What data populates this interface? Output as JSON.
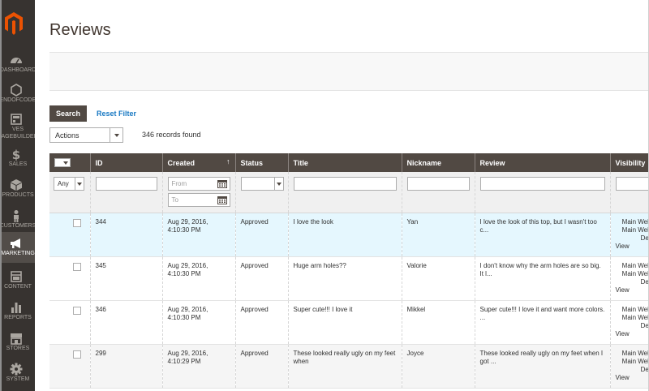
{
  "page": {
    "title": "Reviews"
  },
  "sidebar": {
    "items": [
      {
        "label": "DASHBOARD",
        "icon": "dashboard-icon"
      },
      {
        "label": "VENDOFCODER",
        "icon": "hexagon-icon"
      },
      {
        "label": "VES\nPAGEBUILDER",
        "icon": "page-builder-icon"
      },
      {
        "label": "SALES",
        "icon": "dollar-icon"
      },
      {
        "label": "PRODUCTS",
        "icon": "box-icon"
      },
      {
        "label": "CUSTOMERS",
        "icon": "person-icon"
      },
      {
        "label": "MARKETING",
        "icon": "megaphone-icon",
        "active": true
      },
      {
        "label": "CONTENT",
        "icon": "content-icon"
      },
      {
        "label": "REPORTS",
        "icon": "bar-chart-icon"
      },
      {
        "label": "STORES",
        "icon": "store-icon"
      },
      {
        "label": "SYSTEM",
        "icon": "gear-icon"
      }
    ]
  },
  "toolbar": {
    "search_label": "Search",
    "reset_label": "Reset Filter",
    "actions_label": "Actions",
    "records_found": "346 records found"
  },
  "grid": {
    "columns": [
      "",
      "ID",
      "Created",
      "Status",
      "Title",
      "Nickname",
      "Review",
      "Visibility"
    ],
    "filters": {
      "any": "Any",
      "from_placeholder": "From",
      "to_placeholder": "To"
    },
    "rows": [
      {
        "id": "344",
        "created": "Aug 29, 2016,\n4:10:30 PM",
        "status": "Approved",
        "title": "I love the look",
        "nickname": "Yan",
        "review": "I love the look of this top, but I wasn't too c...",
        "visibility": "Main Website\nMain Website\nDefault",
        "link": "View"
      },
      {
        "id": "345",
        "created": "Aug 29, 2016,\n4:10:30 PM",
        "status": "Approved",
        "title": "Huge arm holes??",
        "nickname": "Valorie",
        "review": "I don't know why the arm holes are so big. It l...",
        "visibility": "Main Website\nMain Website\nDefault",
        "link": "View"
      },
      {
        "id": "346",
        "created": "Aug 29, 2016,\n4:10:30 PM",
        "status": "Approved",
        "title": "Super cute!!! I love it",
        "nickname": "Mikkel",
        "review": "Super cute!!! I love it and want more colors. ...",
        "visibility": "Main Website\nMain Website\nDefault",
        "link": "View"
      },
      {
        "id": "299",
        "created": "Aug 29, 2016,\n4:10:29 PM",
        "status": "Approved",
        "title": "These looked really ugly on my feet when",
        "nickname": "Joyce",
        "review": "These looked really ugly on my feet when I got ...",
        "visibility": "Main Website\nMain Website\nDefault",
        "link": "View"
      }
    ]
  },
  "colors": {
    "sidebar_bg": "#373330",
    "header_bg": "#514943",
    "logo": "#eb5202",
    "link": "#1979c3",
    "highlight_row": "#e5f7fe"
  }
}
